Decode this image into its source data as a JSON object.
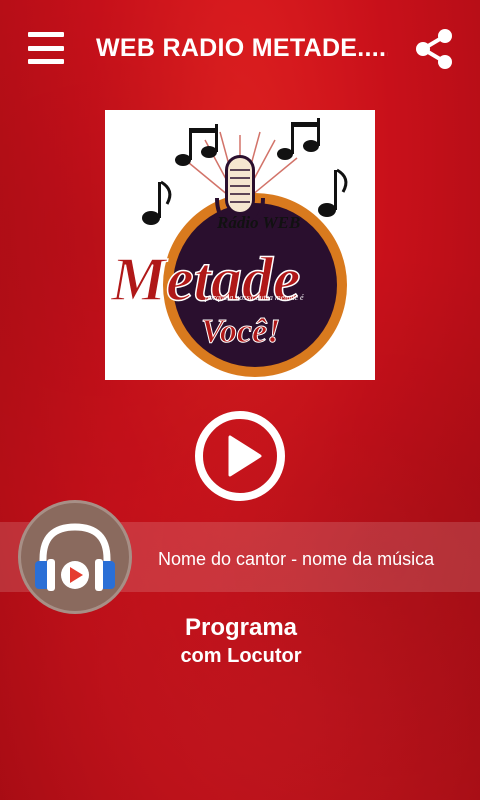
{
  "header": {
    "title": "WEB RADIO METADE.....",
    "menu_icon": "hamburger-menu-icon",
    "share_icon": "share-icon"
  },
  "logo": {
    "line1": "Rádio WEB",
    "line2": "Metade",
    "tagline": "porque a nossa outra metade é",
    "line3": "Você!"
  },
  "player": {
    "play_icon": "play-icon",
    "now_playing": "Nome do cantor - nome da música",
    "avatar_icon": "headphones-icon"
  },
  "program": {
    "name": "Programa",
    "host": "com Locutor"
  },
  "colors": {
    "background": "#c8101a",
    "accent": "#ffffff",
    "logo_dark": "#2a0f2e",
    "logo_orange": "#d97a1e",
    "logo_red": "#b01818"
  }
}
